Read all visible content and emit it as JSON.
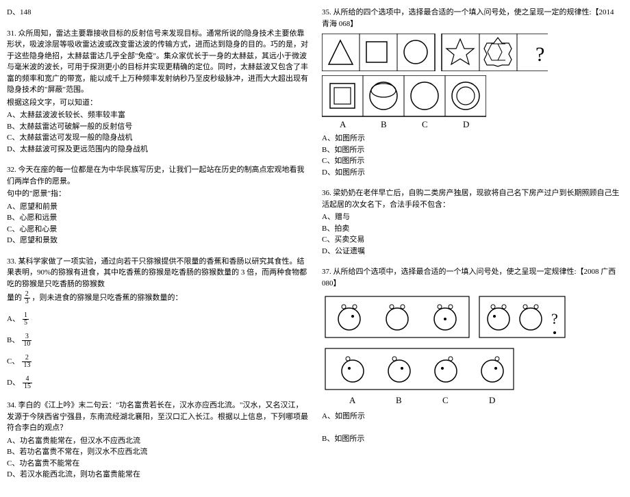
{
  "topOption": "D、148",
  "q31": {
    "text": "31. 众所周知，雷达主要靠接收目标的反射信号来发现目标。通常所说的隐身技术主要依靠形状，吸波涂层等吸收雷达波或改变雷达波的传输方式，进而达到隐身的目的。巧的是，对于这些隐身绝招，太赫兹雷达几乎全部\"免疫\"。集众家优长于一身的太赫兹，其远小于微波与毫米波的波长，可用于探测更小的目标并实现更精确的定位。同时，太赫兹波又包含了丰富的频率和宽广的带宽，能以成千上万种频率发射纳秒乃至皮秒级脉冲，进而大大超出现有隐身技术的\"屏蔽\"范围。",
    "sub": "根据这段文字，可以知道：",
    "opts": {
      "A": "A、太赫兹波波长较长、频率较丰富",
      "B": "B、太赫兹雷达可破解一般的反射信号",
      "C": "C、太赫兹雷达可发现一般的隐身战机",
      "D": "D、太赫兹波可探及更远范围内的隐身战机"
    }
  },
  "q32": {
    "text": "32. 今天在座的每一位都是在为中华民族写历史，让我们一起站在历史的制高点宏观地看我们两岸合作的愿景。",
    "sub": "句中的\"愿景\"指：",
    "opts": {
      "A": "A、愿望和前景",
      "B": "B、心愿和远景",
      "C": "C、心愿和心景",
      "D": "D、愿望和景致"
    }
  },
  "q33": {
    "text": "33. 某科学家做了一项实验，通过向若干只猕猴提供不限量的香蕉和香肠以研究其食性。结果表明，90%的猕猴有进食，其中吃香蕉的猕猴是吃香肠的猕猴数量的 3 倍，而两种食物都吃的猕猴是只吃香肠的猕猴数",
    "mid": "量的",
    "tail": "，则未进食的猕猴是只吃香蕉的猕猴数量的：",
    "optsPrefix": {
      "A": "A、",
      "B": "B、",
      "C": "C、",
      "D": "D、"
    },
    "fractions": {
      "q": {
        "num": "2",
        "den": "3"
      },
      "A": {
        "num": "1",
        "den": "5"
      },
      "B": {
        "num": "3",
        "den": "10"
      },
      "C": {
        "num": "2",
        "den": "13"
      },
      "D": {
        "num": "4",
        "den": "15"
      }
    }
  },
  "q34": {
    "text": "34. 李白的《江上吟》末二句云：\"功名富贵若长在，汉水亦应西北流。\"汉水，又名汉江，发源于今陕西省宁强县，东南流经湖北襄阳，至汉口汇入长江。根据以上信息，下列哪项最符合李白的观点？",
    "opts": {
      "A": "A、功名富贵能常在，但汉水不应西北流",
      "B": "B、若功名富贵不常在，则汉水不应西北流",
      "C": "C、功名富贵不能常在",
      "D": "D、若汉水能西北流，则功名富贵能常在"
    }
  },
  "q35": {
    "text": "35. 从所给的四个选项中，选择最合适的一个填入问号处，使之呈现一定的规律性:【2014 青海 068】",
    "opts": {
      "A": "A、如图所示",
      "B": "B、如图所示",
      "C": "C、如图所示",
      "D": "D、如图所示"
    }
  },
  "q36": {
    "text": "36. 梁奶奶在老伴早亡后，自购二类房产独居，现欲将自己名下房产过户到长期照顾自己生活起居的次女名下，合法手段不包含：",
    "opts": {
      "A": "A、赠与",
      "B": "B、拍卖",
      "C": "C、买卖交易",
      "D": "D、公证遗嘱"
    }
  },
  "q37": {
    "text": "37. 从所给四个选项中，选择最合适的一个填入问号处，使之呈现一定规律性:【2008 广西 080】",
    "opts": {
      "A": "A、如图所示",
      "B": "B、如图所示"
    }
  },
  "labels": {
    "A": "A",
    "B": "B",
    "C": "C",
    "D": "D"
  }
}
